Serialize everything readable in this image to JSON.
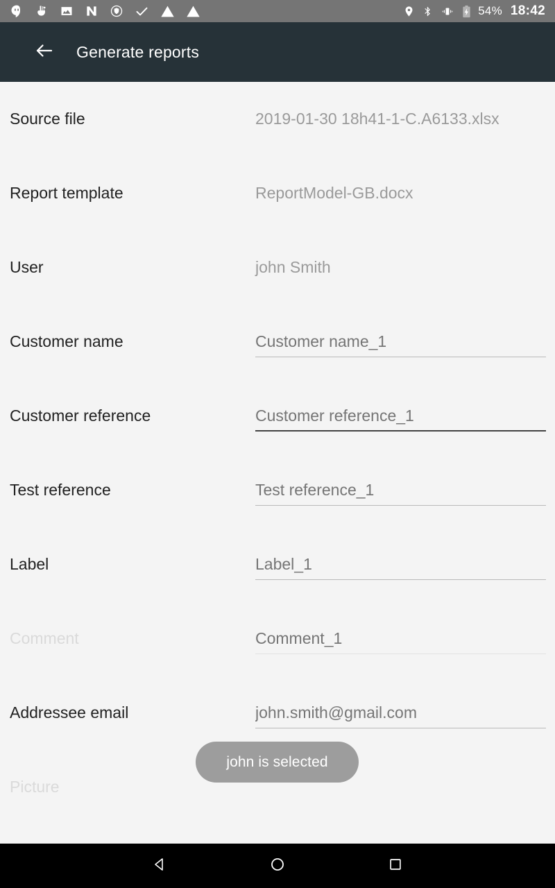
{
  "status_bar": {
    "icons_left": [
      "hangouts-icon",
      "touch-gesture-icon",
      "photo-icon",
      "n-logo-icon",
      "shield-icon",
      "check-icon",
      "warning-icon",
      "warning-icon"
    ],
    "icons_right": [
      "location-icon",
      "bluetooth-icon",
      "vibrate-icon",
      "battery-charging-icon"
    ],
    "battery_percent": "54%",
    "clock": "18:42",
    "background": "#757575"
  },
  "toolbar": {
    "back_icon": "arrow-back-icon",
    "title": "Generate reports",
    "background": "#263238"
  },
  "form": {
    "rows": [
      {
        "label": "Source file",
        "type": "static",
        "value": "2019-01-30 18h41-1-C.A6133.xlsx",
        "disabled": false,
        "focused": false
      },
      {
        "label": "Report template",
        "type": "static",
        "value": "ReportModel-GB.docx",
        "disabled": false,
        "focused": false
      },
      {
        "label": "User",
        "type": "static",
        "value": "john Smith",
        "disabled": false,
        "focused": false
      },
      {
        "label": "Customer name",
        "type": "input",
        "value": "",
        "placeholder": "Customer name_1",
        "disabled": false,
        "focused": false
      },
      {
        "label": "Customer reference",
        "type": "input",
        "value": "",
        "placeholder": "Customer reference_1",
        "disabled": false,
        "focused": true
      },
      {
        "label": "Test reference",
        "type": "input",
        "value": "",
        "placeholder": "Test reference_1",
        "disabled": false,
        "focused": false
      },
      {
        "label": "Label",
        "type": "input",
        "value": "",
        "placeholder": "Label_1",
        "disabled": false,
        "focused": false
      },
      {
        "label": "Comment",
        "type": "input",
        "value": "",
        "placeholder": "Comment_1",
        "disabled": true,
        "focused": false
      },
      {
        "label": "Addressee email",
        "type": "input",
        "value": "",
        "placeholder": "john.smith@gmail.com",
        "disabled": false,
        "focused": false
      },
      {
        "label": "Picture",
        "type": "static",
        "value": "",
        "disabled": true,
        "focused": false
      }
    ]
  },
  "toast": {
    "message": "john is selected",
    "background": "#9d9d9d",
    "text_color": "#ffffff"
  },
  "nav_bar": {
    "back": "nav-back-icon",
    "home": "nav-home-icon",
    "recents": "nav-recents-icon",
    "background": "#000000"
  },
  "colors": {
    "toolbar": "#263238",
    "status_bar": "#757575",
    "content_background": "#f4f4f4",
    "label": "#212121",
    "value": "#9a9a9a",
    "disabled": "#dadada",
    "focused_underline": "#424242"
  }
}
